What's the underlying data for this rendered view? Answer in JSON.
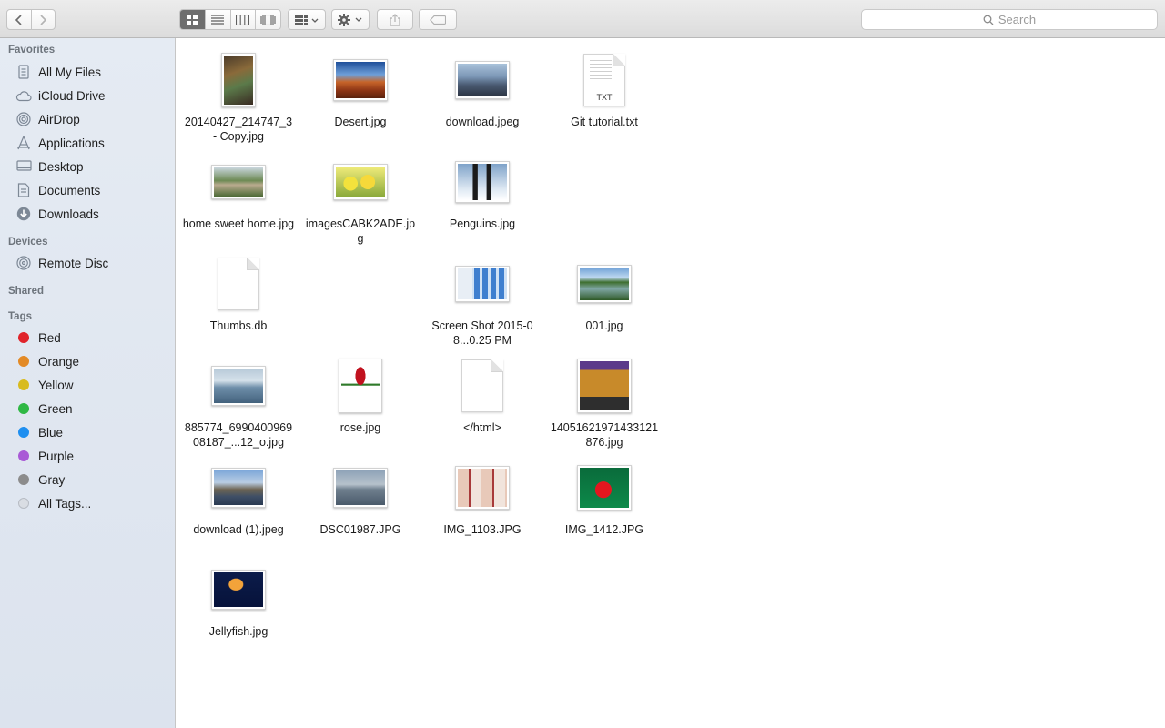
{
  "toolbar": {
    "search_placeholder": "Search"
  },
  "sidebar": {
    "favorites_header": "Favorites",
    "favorites": [
      {
        "label": "All My Files",
        "icon": "all-files-icon"
      },
      {
        "label": "iCloud Drive",
        "icon": "cloud-icon"
      },
      {
        "label": "AirDrop",
        "icon": "airdrop-icon"
      },
      {
        "label": "Applications",
        "icon": "applications-icon"
      },
      {
        "label": "Desktop",
        "icon": "desktop-icon"
      },
      {
        "label": "Documents",
        "icon": "document-icon"
      },
      {
        "label": "Downloads",
        "icon": "download-icon"
      }
    ],
    "devices_header": "Devices",
    "devices": [
      {
        "label": "Remote Disc",
        "icon": "disc-icon"
      }
    ],
    "shared_header": "Shared",
    "tags_header": "Tags",
    "tags": [
      {
        "label": "Red",
        "color": "#e0242b"
      },
      {
        "label": "Orange",
        "color": "#e38a26"
      },
      {
        "label": "Yellow",
        "color": "#d8bb1f"
      },
      {
        "label": "Green",
        "color": "#2fb844"
      },
      {
        "label": "Blue",
        "color": "#1f8ff0"
      },
      {
        "label": "Purple",
        "color": "#a95ad6"
      },
      {
        "label": "Gray",
        "color": "#8c8c8c"
      },
      {
        "label": "All Tags...",
        "color": "#cfcfcf"
      }
    ]
  },
  "files": [
    {
      "name": "20140427_214747_3 - Copy.jpg",
      "kind": "image",
      "icon": "photo-portrait-icon"
    },
    {
      "name": "Desert.jpg",
      "kind": "image",
      "icon": "photo-desert-icon"
    },
    {
      "name": "download.jpeg",
      "kind": "image",
      "icon": "photo-city-icon"
    },
    {
      "name": "Git tutorial.txt",
      "kind": "text",
      "ext": "TXT",
      "icon": "text-file-icon"
    },
    {
      "name": "home sweet home.jpg",
      "kind": "image",
      "icon": "photo-house-icon"
    },
    {
      "name": "imagesCABK2ADE.jpg",
      "kind": "image",
      "icon": "photo-tulips-icon"
    },
    {
      "name": "Penguins.jpg",
      "kind": "image",
      "icon": "photo-penguins-icon"
    },
    {
      "name": "Thumbs.db",
      "kind": "blank",
      "icon": "blank-file-icon"
    },
    {
      "name": "Screen Shot 2015-08...0.25 PM",
      "kind": "image",
      "icon": "screenshot-icon"
    },
    {
      "name": "001.jpg",
      "kind": "image",
      "icon": "photo-river-icon"
    },
    {
      "name": "885774_699040096908187_...12_o.jpg",
      "kind": "image",
      "icon": "photo-sea-icon"
    },
    {
      "name": "rose.jpg",
      "kind": "image",
      "icon": "photo-rose-icon"
    },
    {
      "name": "</html>",
      "kind": "blank",
      "icon": "blank-file-icon"
    },
    {
      "name": "14051621971433121876.jpg",
      "kind": "image",
      "icon": "photo-poster-icon"
    },
    {
      "name": "download (1).jpeg",
      "kind": "image",
      "icon": "photo-bridge-icon"
    },
    {
      "name": "DSC01987.JPG",
      "kind": "image",
      "icon": "photo-lake-icon"
    },
    {
      "name": "IMG_1103.JPG",
      "kind": "image",
      "icon": "photo-collage-icon"
    },
    {
      "name": "IMG_1412.JPG",
      "kind": "image",
      "icon": "photo-flag-icon"
    },
    {
      "name": "Jellyfish.jpg",
      "kind": "image",
      "icon": "photo-jellyfish-icon"
    }
  ]
}
